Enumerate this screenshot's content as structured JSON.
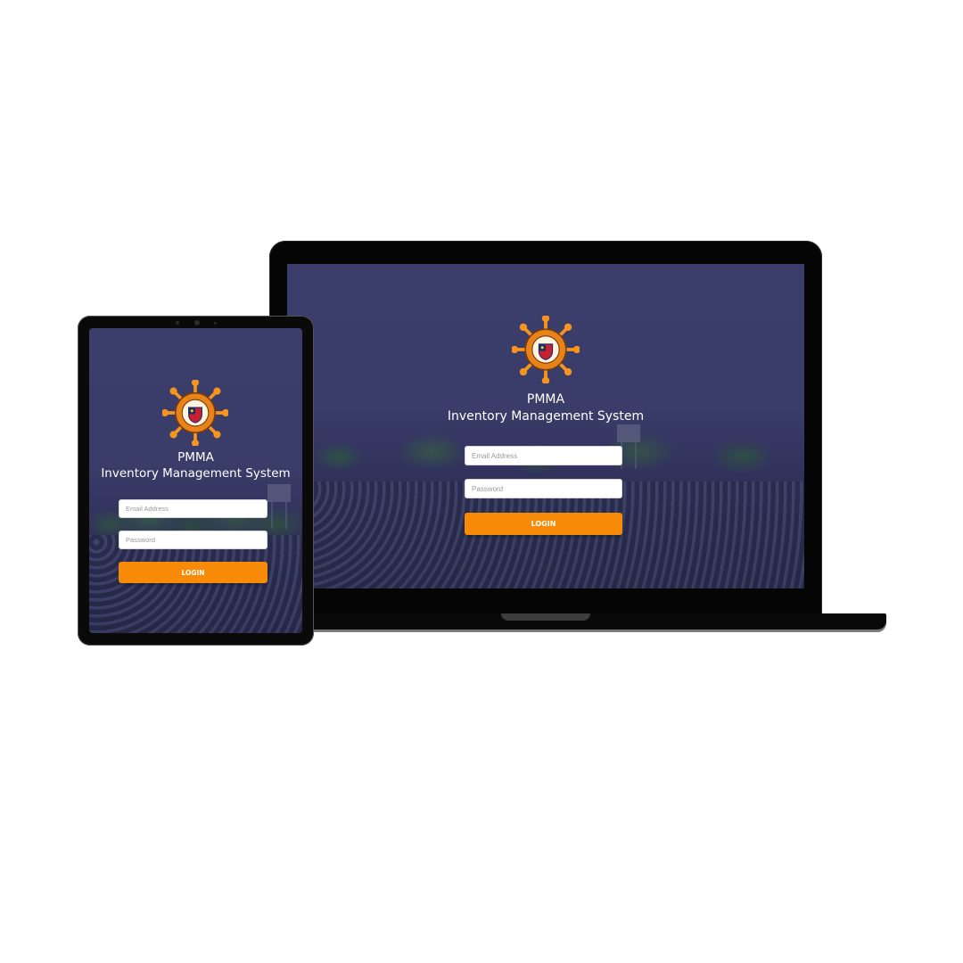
{
  "app": {
    "title_line1": "PMMA",
    "title_line2": "Inventory Management System",
    "accent_color": "#f78a06",
    "background_color": "#3b3d6b"
  },
  "login_form": {
    "email_placeholder": "Email Address",
    "password_placeholder": "Password",
    "login_label": "LOGIN"
  },
  "icons": {
    "logo": "pmma-seal-ship-wheel-icon"
  }
}
